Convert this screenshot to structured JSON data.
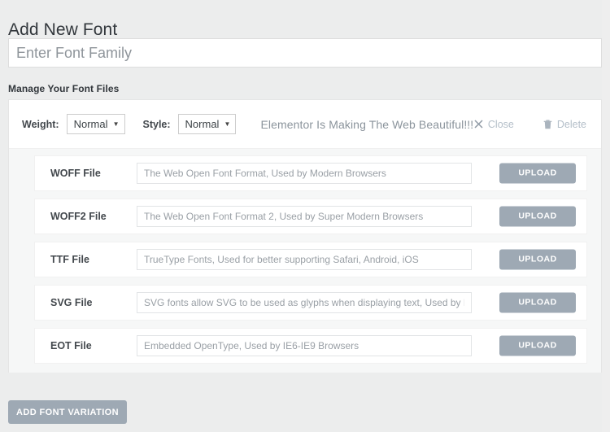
{
  "page": {
    "title": "Add New Font",
    "section_label": "Manage Your Font Files",
    "background_color": "#eceded"
  },
  "font_family_field": {
    "name": "font-family-input",
    "value": "",
    "placeholder": "Enter Font Family"
  },
  "variation": {
    "weight": {
      "label": "Weight:",
      "selected": "Normal",
      "options": [
        "Normal"
      ]
    },
    "style": {
      "label": "Style:",
      "selected": "Normal",
      "options": [
        "Normal"
      ]
    },
    "preview_text": "Elementor Is Making The Web Beautiful!!!",
    "close_label": "Close",
    "close_icon": "close-x-icon",
    "delete_label": "Delete",
    "delete_icon": "trash-icon",
    "files": [
      {
        "label": "WOFF File",
        "value": "",
        "placeholder": "The Web Open Font Format, Used by Modern Browsers",
        "upload_label": "UPLOAD",
        "input_width": 412
      },
      {
        "label": "WOFF2 File",
        "value": "",
        "placeholder": "The Web Open Font Format 2, Used by Super Modern Browsers",
        "upload_label": "UPLOAD",
        "input_width": 412
      },
      {
        "label": "TTF File",
        "value": "",
        "placeholder": "TrueType Fonts, Used for better supporting Safari, Android, iOS",
        "upload_label": "UPLOAD",
        "input_width": 412
      },
      {
        "label": "SVG File",
        "value": "",
        "placeholder": "SVG fonts allow SVG to be used as glyphs when displaying text, Used by Legacy iOS",
        "upload_label": "UPLOAD",
        "input_width": 412
      },
      {
        "label": "EOT File",
        "value": "",
        "placeholder": "Embedded OpenType, Used by IE6-IE9 Browsers",
        "upload_label": "UPLOAD",
        "input_width": 412
      }
    ]
  },
  "add_variation_button": {
    "label": "ADD FONT VARIATION",
    "color": "#9ea9b4"
  },
  "colors": {
    "button_gray": "#9ea9b4",
    "text_dark": "#32373c",
    "text_muted": "#8b949c",
    "card_white": "#ffffff",
    "row_region": "#f6f7f7"
  }
}
